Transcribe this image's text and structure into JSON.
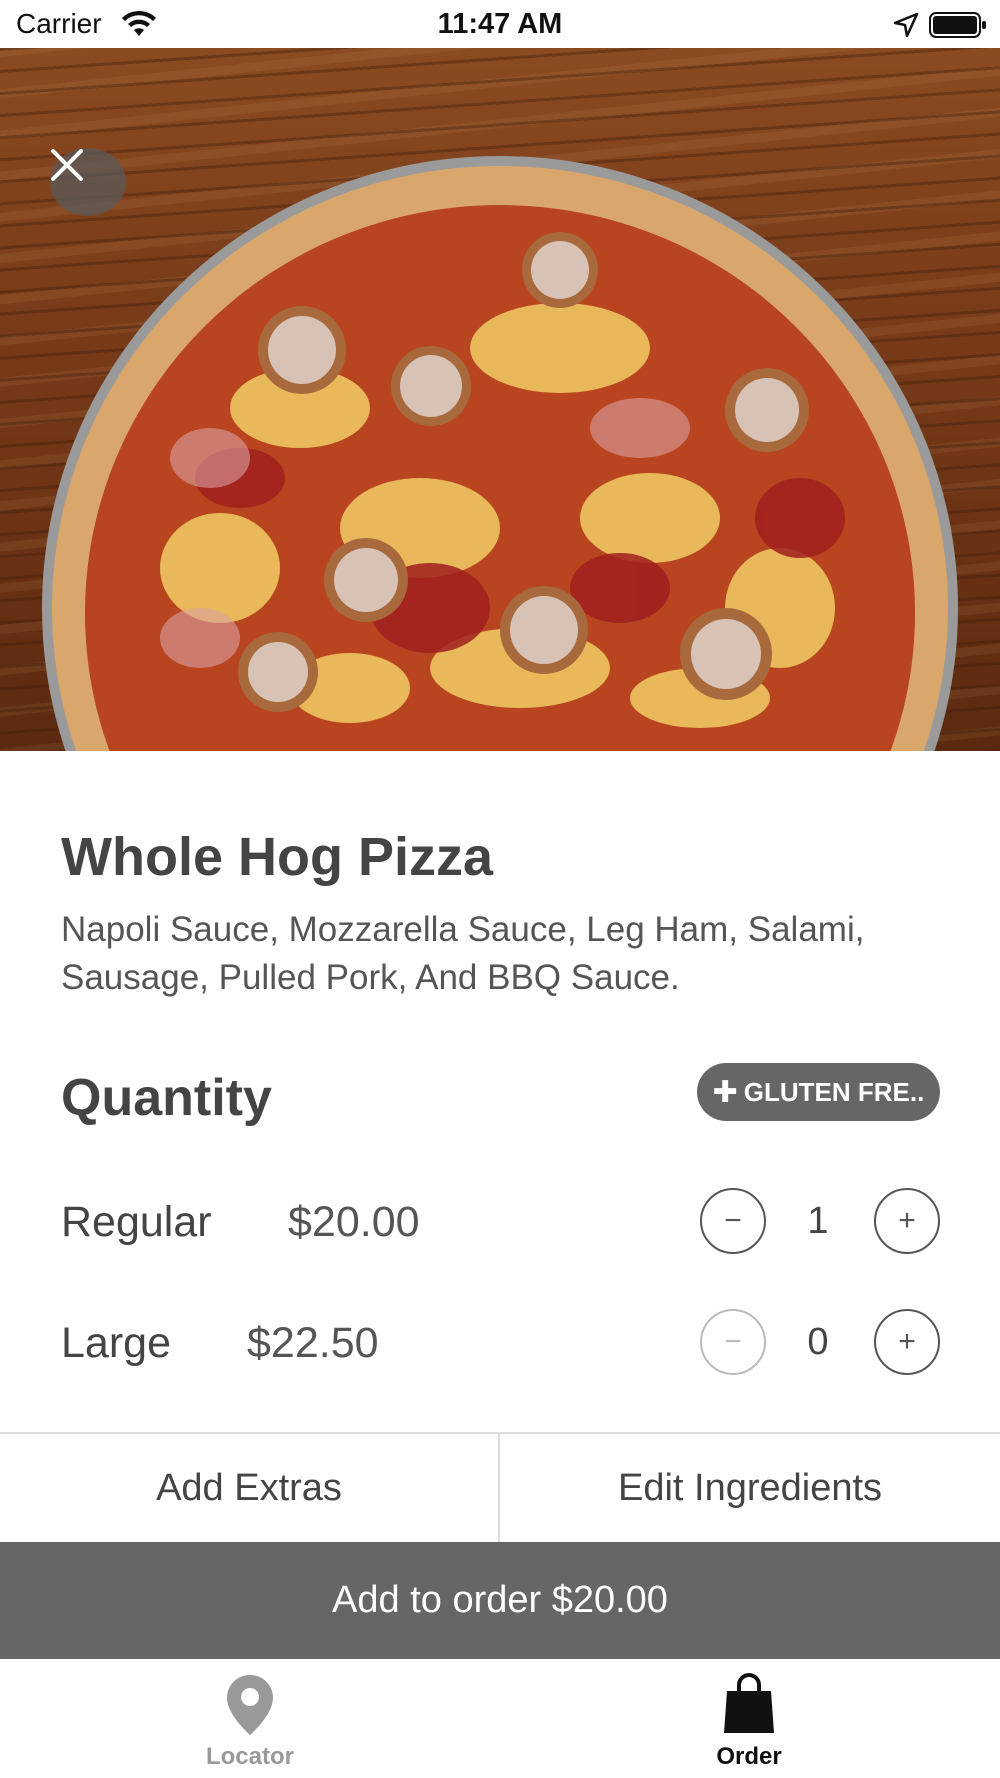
{
  "status_bar": {
    "carrier": "Carrier",
    "time": "11:47 AM"
  },
  "product": {
    "name": "Whole Hog Pizza",
    "description": "Napoli Sauce, Mozzarella Sauce, Leg Ham, Salami, Sausage, Pulled Pork, And BBQ Sauce.",
    "image_icon": "pizza-photo"
  },
  "quantity": {
    "heading": "Quantity",
    "gluten_free_label": "GLUTEN FRE..",
    "sizes": [
      {
        "name": "Regular",
        "price": "$20.00",
        "count": "1",
        "decrement_enabled": true
      },
      {
        "name": "Large",
        "price": "$22.50",
        "count": "0",
        "decrement_enabled": false
      }
    ]
  },
  "actions": {
    "add_extras": "Add Extras",
    "edit_ingredients": "Edit Ingredients",
    "add_to_order": "Add to order $20.00"
  },
  "tab_bar": {
    "tabs": [
      {
        "label": "Locator",
        "icon": "map-pin-icon",
        "active": false
      },
      {
        "label": "Order",
        "icon": "shopping-bag-icon",
        "active": true
      }
    ]
  },
  "colors": {
    "accent_gray": "#666666",
    "text": "#444444"
  }
}
